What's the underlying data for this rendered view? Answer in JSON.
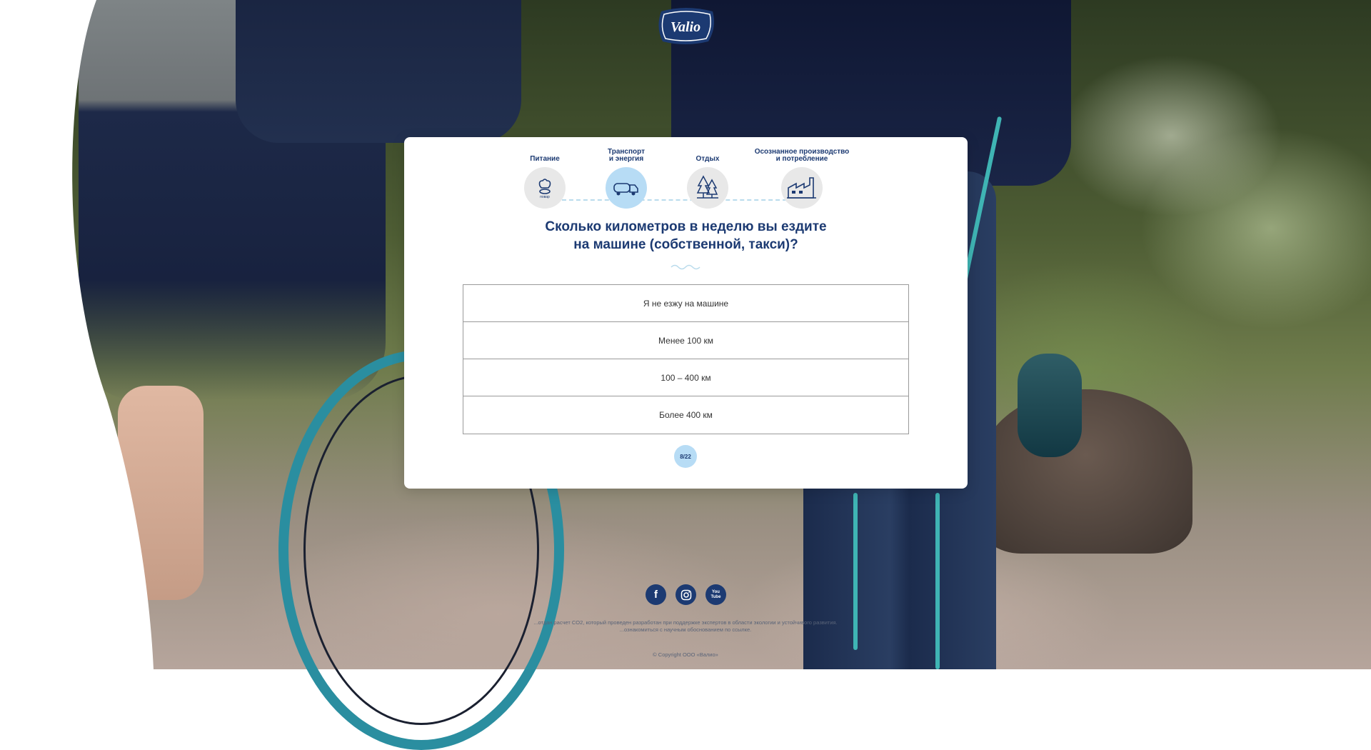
{
  "brand": {
    "logo_text": "Valio"
  },
  "steps": [
    {
      "label": "Питание",
      "icon": "chef-hat-icon",
      "icon_caption": "повар",
      "active": false
    },
    {
      "label": "Транспорт\nи энергия",
      "icon": "truck-icon",
      "active": true
    },
    {
      "label": "Отдых",
      "icon": "trees-icon",
      "active": false
    },
    {
      "label": "Осознанное производство\nи потребление",
      "icon": "factory-icon",
      "active": false
    }
  ],
  "question": {
    "line1": "Сколько километров в неделю вы ездите",
    "line2": "на машине (собственной, такси)?"
  },
  "options": [
    "Я не езжу на машине",
    "Менее 100 км",
    "100 – 400 км",
    "Более 400 км"
  ],
  "progress": {
    "label": "8/22",
    "current": 8,
    "total": 22
  },
  "social": [
    {
      "name": "facebook",
      "glyph": "f"
    },
    {
      "name": "instagram",
      "glyph": ""
    },
    {
      "name": "youtube",
      "glyph": "You Tube"
    }
  ],
  "footer": {
    "line1": "...отдан расчет CO2, который проведен разработан при поддержке экспертов в области экологии и устойчивого развития.",
    "line2": "...ознакомиться с научным обоснованием по ссылке.",
    "copyright": "© Copyright ООО «Валио»"
  },
  "colors": {
    "primary": "#1c3a72",
    "accent": "#b7dcf5",
    "line": "#b9dbec"
  }
}
